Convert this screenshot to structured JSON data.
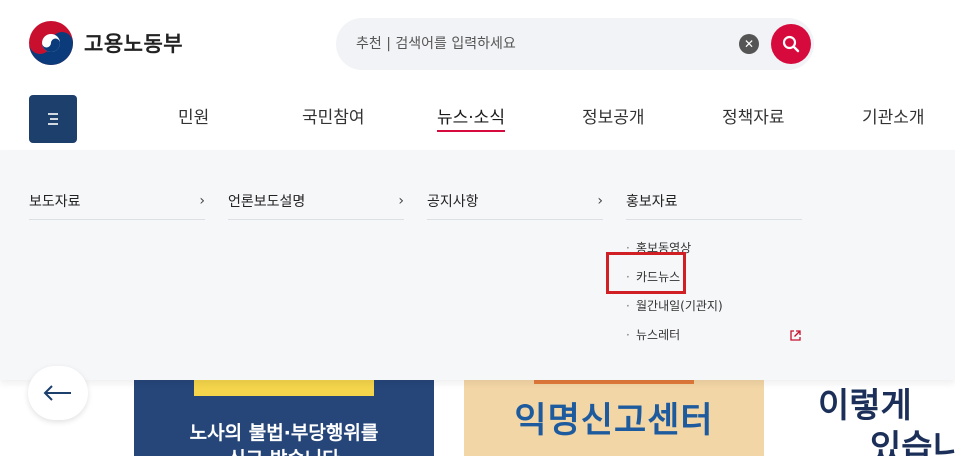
{
  "site": {
    "name": "고용노동부"
  },
  "search": {
    "placeholder": "추천 | 검색어를 입력하세요",
    "clear_icon": "clear-icon",
    "search_icon": "search-icon",
    "accent_color": "#d60a3c"
  },
  "menu_button_icon": "menu-icon",
  "gnb": {
    "items": [
      {
        "label": "민원"
      },
      {
        "label": "국민참여"
      },
      {
        "label": "뉴스·소식",
        "active": true
      },
      {
        "label": "정보공개"
      },
      {
        "label": "정책자료"
      },
      {
        "label": "기관소개"
      }
    ]
  },
  "dropdown": {
    "columns": [
      {
        "label": "보도자료",
        "chevron": "›"
      },
      {
        "label": "언론보도설명",
        "chevron": "›"
      },
      {
        "label": "공지사항",
        "chevron": "›"
      },
      {
        "label": "홍보자료",
        "chevron": "",
        "sub_items": [
          {
            "label": "홍보동영상"
          },
          {
            "label": "카드뉴스",
            "highlighted": true
          },
          {
            "label": "월간내일(기관지)"
          },
          {
            "label": "뉴스레터",
            "external": true
          }
        ]
      }
    ],
    "bullet": "·"
  },
  "banners": {
    "prev_icon": "arrow-left-icon",
    "b1": {
      "line1": "노사의 불법·부당행위를",
      "line2": "신고 받습니다"
    },
    "b2": {
      "text": "익명신고센터"
    },
    "b3": {
      "line1": "이렇게",
      "line2": "있습니"
    }
  }
}
